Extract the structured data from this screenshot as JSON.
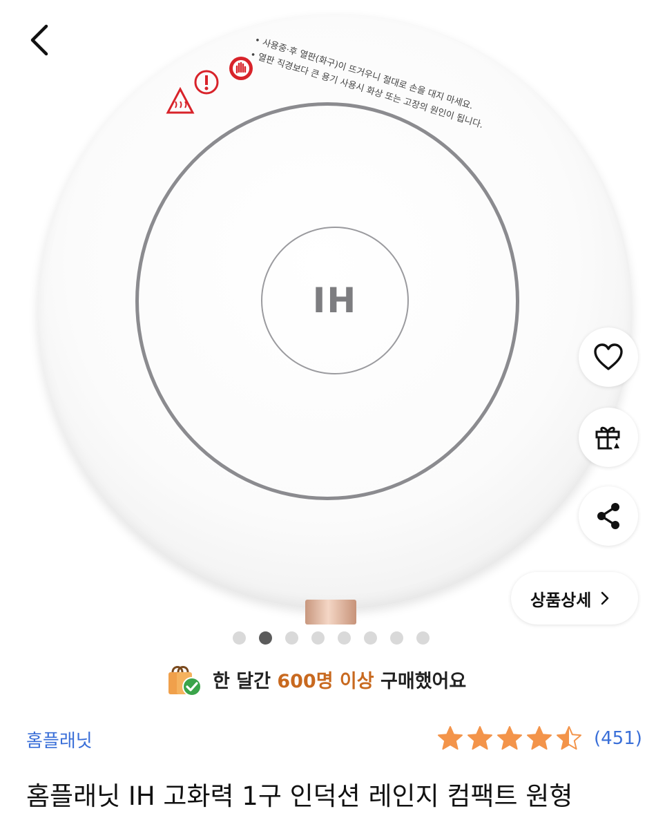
{
  "hero": {
    "plate_label": "IH",
    "warning_line1": "• 사용중·후 열판(화구)이 뜨거우니 절대로 손을 대지 마세요.",
    "warning_line2": "• 열판 직경보다 큰 용기 사용시 화상 또는 고장의 원인이 됩니다."
  },
  "actions": {
    "detail_label": "상품상세"
  },
  "carousel": {
    "dots": [
      {
        "active": false
      },
      {
        "active": true
      },
      {
        "active": false
      },
      {
        "active": false
      },
      {
        "active": false
      },
      {
        "active": false
      },
      {
        "active": false
      },
      {
        "active": false
      }
    ]
  },
  "purchase_badge": {
    "prefix": "한 달간",
    "highlight": "600명 이상",
    "suffix": "구매했어요",
    "highlight_color": "#c8691f"
  },
  "product": {
    "seller": "홈플래닛",
    "rating": 4.5,
    "rating_max": 5,
    "review_count": "(451)",
    "title": "홈플래닛 IH 고화력 1구 인덕션 레인지 컴팩트 원형"
  },
  "colors": {
    "link_blue": "#3a6fd8",
    "star_orange": "#f3944a",
    "warning_red": "#d8232a"
  },
  "icons": {
    "back": "chevron-left-icon",
    "wishlist": "heart-icon",
    "gift": "gift-icon",
    "share": "share-icon",
    "detail_arrow": "chevron-right-icon",
    "badge": "shopping-bag-check-icon"
  }
}
